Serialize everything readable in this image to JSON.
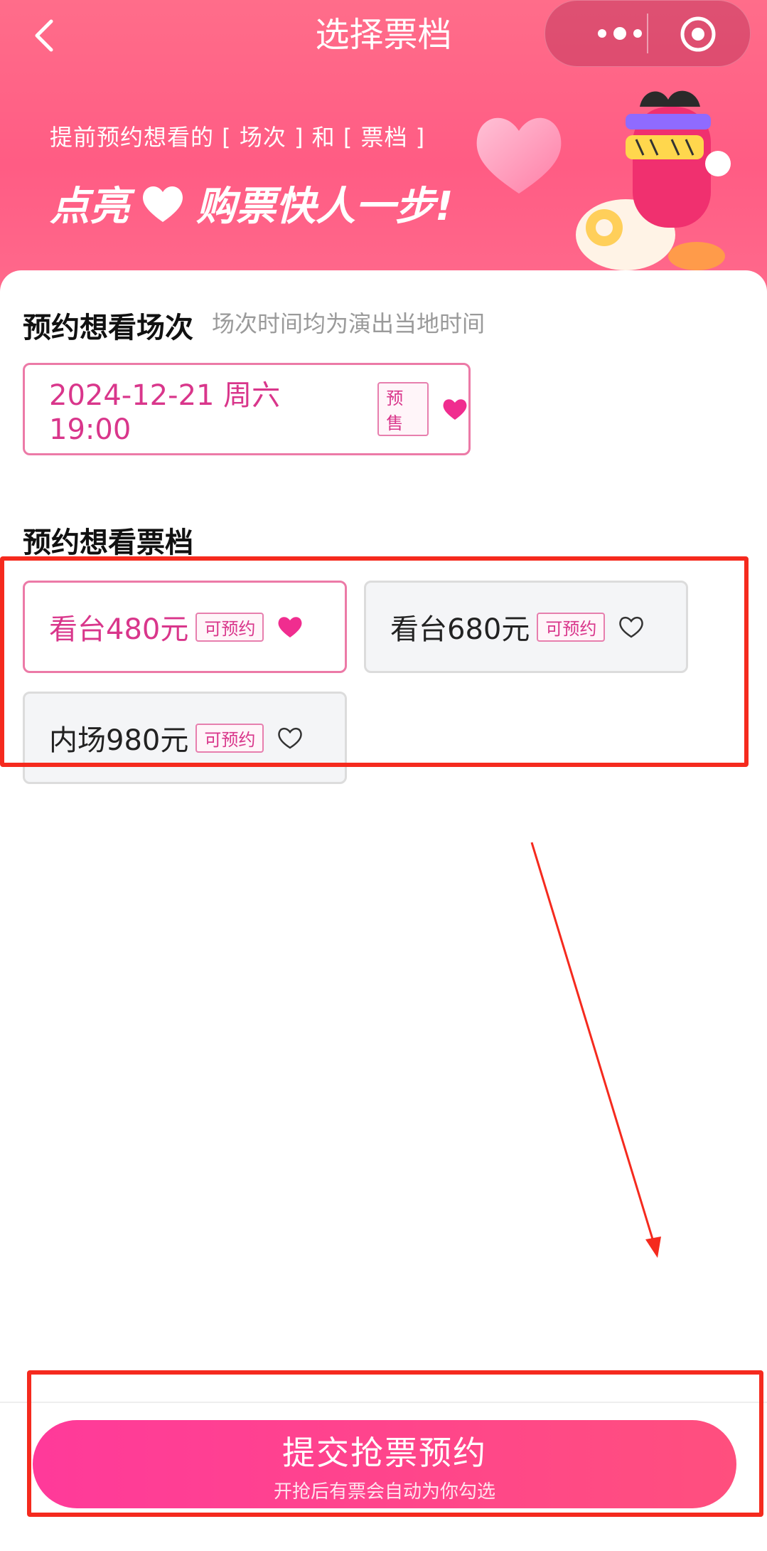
{
  "nav": {
    "title": "选择票档"
  },
  "banner": {
    "line1": "提前预约想看的 [ 场次 ] 和 [ 票档 ]",
    "line2_left": "点亮",
    "line2_right": "购票快人一步!"
  },
  "session_section": {
    "title": "预约想看场次",
    "subtitle": "场次时间均为演出当地时间",
    "options": [
      {
        "label": "2024-12-21 周六 19:00",
        "tag": "预售",
        "selected": true
      }
    ]
  },
  "price_section": {
    "title": "预约想看票档",
    "options": [
      {
        "label": "看台480元",
        "tag": "可预约",
        "selected": true
      },
      {
        "label": "看台680元",
        "tag": "可预约",
        "selected": false
      },
      {
        "label": "内场980元",
        "tag": "可预约",
        "selected": false
      }
    ]
  },
  "submit": {
    "label": "提交抢票预约",
    "sub_label": "开抢后有票会自动为你勾选"
  },
  "colors": {
    "accent": "#ff4f7e",
    "selected_text": "#d9368b",
    "annotation_red": "#f52a1e"
  },
  "icons": [
    "chevron-left-icon",
    "more-dots-icon",
    "target-icon",
    "heart-icon",
    "heart-outline-icon"
  ]
}
